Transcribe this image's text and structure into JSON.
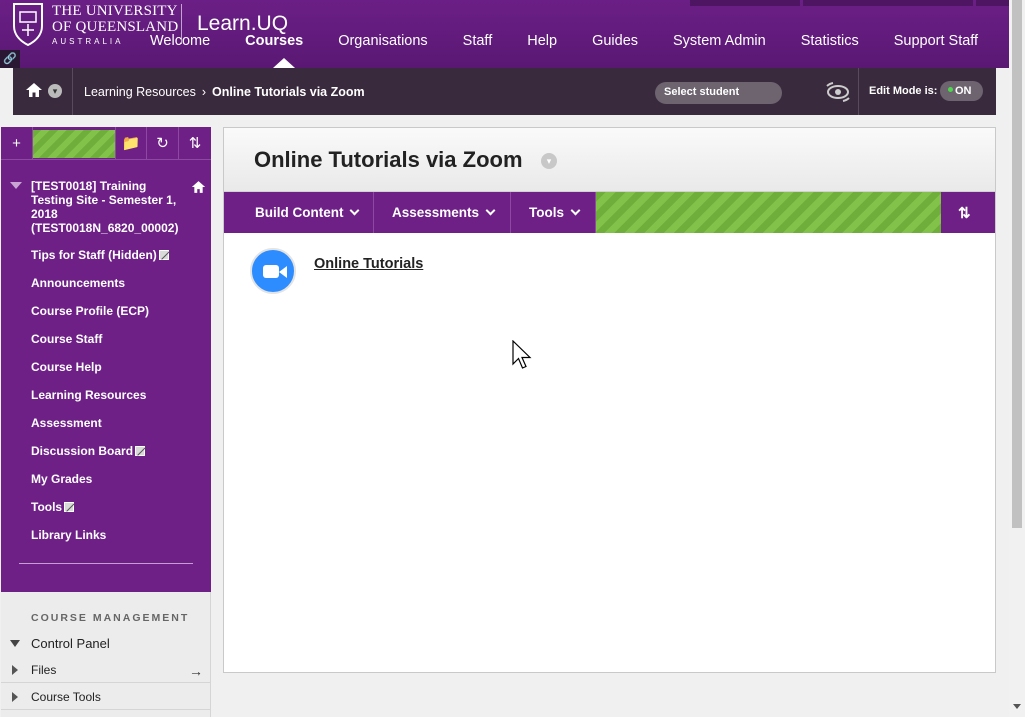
{
  "header": {
    "university_line1": "THE UNIVERSITY",
    "university_line2": "OF QUEENSLAND",
    "university_line3": "AUSTRALIA",
    "brand": "Learn.UQ",
    "nav": [
      {
        "label": "Welcome",
        "active": false
      },
      {
        "label": "Courses",
        "active": true
      },
      {
        "label": "Organisations",
        "active": false
      },
      {
        "label": "Staff",
        "active": false
      },
      {
        "label": "Help",
        "active": false
      },
      {
        "label": "Guides",
        "active": false
      },
      {
        "label": "System Admin",
        "active": false
      },
      {
        "label": "Statistics",
        "active": false
      },
      {
        "label": "Support Staff",
        "active": false
      }
    ]
  },
  "breadcrumb": {
    "items": [
      "Learning Resources",
      "Online Tutorials via Zoom"
    ],
    "separator": "›",
    "select_student": "Select student",
    "edit_mode_label": "Edit Mode is:",
    "edit_mode_state": "ON"
  },
  "course_menu": {
    "course_title": "[TEST0018] Training Testing Site - Semester 1, 2018 (TEST0018N_6820_00002)",
    "items": [
      {
        "label": "Tips for Staff (Hidden)",
        "hidden_icon": true
      },
      {
        "label": "Announcements",
        "hidden_icon": false
      },
      {
        "label": "Course Profile (ECP)",
        "hidden_icon": false
      },
      {
        "label": "Course Staff",
        "hidden_icon": false
      },
      {
        "label": "Course Help",
        "hidden_icon": false
      },
      {
        "label": "Learning Resources",
        "hidden_icon": false
      },
      {
        "label": "Assessment",
        "hidden_icon": false
      },
      {
        "label": "Discussion Board",
        "hidden_icon": true
      },
      {
        "label": "My Grades",
        "hidden_icon": false
      },
      {
        "label": "Tools",
        "hidden_icon": true
      },
      {
        "label": "Library Links",
        "hidden_icon": false
      }
    ]
  },
  "course_management": {
    "heading": "COURSE MANAGEMENT",
    "control_panel": "Control Panel",
    "files": "Files",
    "course_tools": "Course Tools"
  },
  "content": {
    "title": "Online Tutorials via Zoom",
    "actions": {
      "build_content": "Build Content",
      "assessments": "Assessments",
      "tools": "Tools"
    },
    "item": {
      "label": "Online Tutorials",
      "icon": "zoom-video-icon"
    }
  },
  "colors": {
    "primary_purple": "#6e2087",
    "breadcrumb_bg": "#3a2a3d",
    "stripe_green": "#82c24a",
    "zoom_blue": "#2d8cff"
  }
}
